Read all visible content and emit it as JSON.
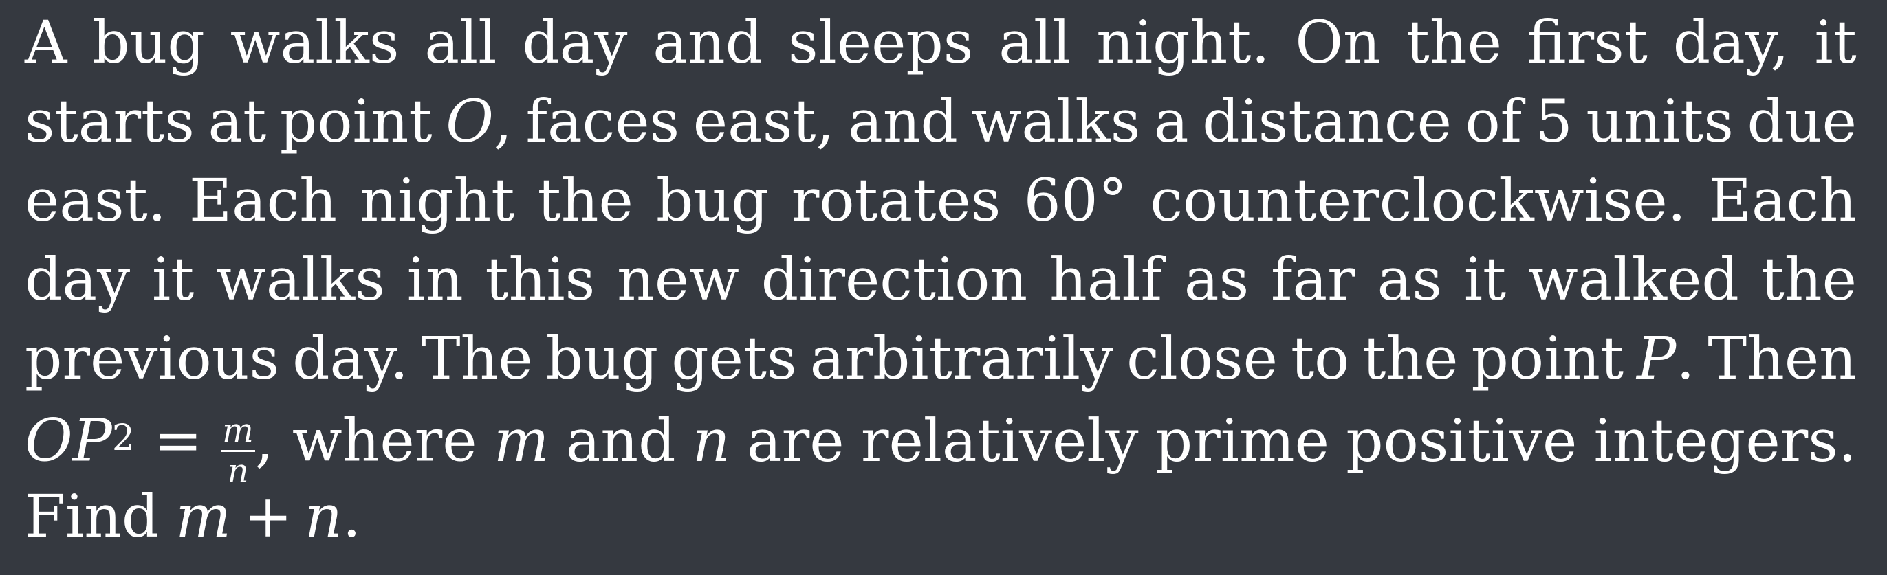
{
  "problem": {
    "lines": [
      [
        "A",
        "bug",
        "walks",
        "all",
        "day",
        "and",
        "sleeps",
        "all",
        "night.",
        "On",
        "the",
        "first",
        "day,",
        "it"
      ],
      [
        "starts",
        "at",
        "point",
        "O",
        ",",
        "faces",
        "east,",
        "and",
        "walks",
        "a",
        "distance",
        "of",
        "5",
        "units",
        "due"
      ],
      [
        "east.",
        "Each",
        "night",
        "the",
        "bug",
        "rotates",
        "60°",
        "counterclockwise.",
        "Each"
      ],
      [
        "day",
        "it",
        "walks",
        "in",
        "this",
        "new",
        "direction",
        "half",
        "as",
        "far",
        "as",
        "it",
        "walked",
        "the"
      ],
      [
        "previous",
        "day.",
        "The",
        "bug",
        "gets",
        "arbitrarily",
        "close",
        "to",
        "the",
        "point",
        "P",
        ".",
        "Then"
      ],
      {
        "op": "OP",
        "exp": "2",
        "eq": "=",
        "frac_num": "m",
        "frac_den": "n",
        "rest": [
          ", where",
          "m",
          "and",
          "n",
          "are",
          "relatively",
          "prime",
          "positive",
          "integers."
        ]
      },
      [
        "Find",
        "m",
        "+",
        "n",
        "."
      ]
    ]
  }
}
